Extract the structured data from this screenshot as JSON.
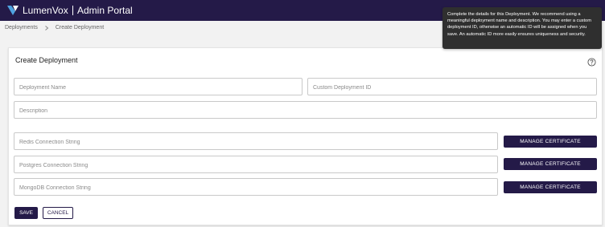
{
  "header": {
    "brand": "LumenVox",
    "title": "Admin Portal"
  },
  "breadcrumb": {
    "items": [
      "Deployments",
      "Create Deployment"
    ]
  },
  "page": {
    "title": "Create Deployment"
  },
  "form": {
    "deployment_name_placeholder": "Deployment Name",
    "deployment_name_value": "",
    "custom_id_placeholder": "Custom Deployment ID",
    "custom_id_value": "",
    "description_placeholder": "Description",
    "description_value": "",
    "redis_placeholder": "Redis Connection String",
    "redis_value": "",
    "postgres_placeholder": "Postgres Connection String",
    "postgres_value": "",
    "mongodb_placeholder": "MongoDB Connection String",
    "mongodb_value": "",
    "manage_certificate_label": "MANAGE CERTIFICATE"
  },
  "actions": {
    "save": "SAVE",
    "cancel": "CANCEL"
  },
  "tooltip": {
    "text": "Complete the details for this Deployment. We recommend using a meaningful deployment name and description. You may enter a custom deployment ID, otherwise an automatic ID will be assigned when you save. An automatic ID more easily ensures uniqueness and security."
  },
  "icons": {
    "logo": "lumenvox-logo-icon",
    "breadcrumb_separator": "chevron-right-icon",
    "help": "help-circle-icon"
  },
  "colors": {
    "brand": "#241a48",
    "logo_accent": "#4fa3e0",
    "page_background": "#f2f2f2",
    "tooltip_background": "#2f2f2f"
  }
}
